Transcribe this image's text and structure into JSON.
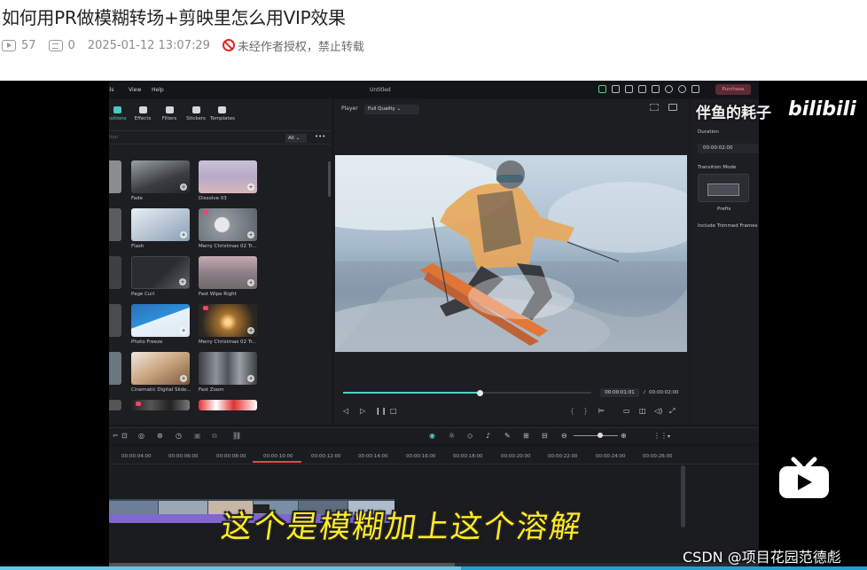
{
  "article": {
    "title": "如何用PR做模糊转场+剪映里怎么用VIP效果",
    "views": "57",
    "comments": "0",
    "datetime": "2025-01-12 13:07:29",
    "copyright": "未经作者授权，禁止转载"
  },
  "editor": {
    "menu": [
      "ols",
      "View",
      "Help"
    ],
    "window_title": "Untitled",
    "purchase_label": "Purchase",
    "categories": [
      "nsitions",
      "Effects",
      "Filters",
      "Stickers",
      "Templates"
    ],
    "search_placeholder": "ition",
    "filter_all": "All",
    "thumbnails": [
      {
        "label": "Fade"
      },
      {
        "label": "Dissolve 03"
      },
      {
        "label": "Flash"
      },
      {
        "label": "Merry Christmas 02 Tr..."
      },
      {
        "label": "Page Curl"
      },
      {
        "label": "Fast Wipe Right"
      },
      {
        "label": "Photo Freeze"
      },
      {
        "label": "Merry Christmas 02 Tr..."
      },
      {
        "label": "Cinematic Digital Slide..."
      },
      {
        "label": "Fast Zoom"
      }
    ],
    "player": {
      "label": "Player",
      "quality": "Full Quality",
      "current_time": "00:00:01:01",
      "separator": "/",
      "total_time": "00:00:02:00",
      "progress": 0.55
    },
    "properties": {
      "duration_label": "Duration",
      "duration_value": "00:00:02:00",
      "transition_mode_label": "Transition Mode",
      "mode_option": "Prefix",
      "include_trimmed": "Include Trimmed Frames"
    },
    "ruler_ticks": [
      "00:00:04:00",
      "00:00:06:00",
      "00:00:08:00",
      "00:00:10:00",
      "00:00:12:00",
      "00:00:14:00",
      "00:00:16:00",
      "00:00:18:00",
      "00:00:20:00",
      "00:00:22:00",
      "00:00:24:00",
      "00:00:26:00"
    ]
  },
  "subtitle": "这个是模糊加上这个溶解",
  "watermark": {
    "channel": "伴鱼的耗子",
    "brand": "bilibili",
    "csdn": "CSDN @项目花园范德彪"
  },
  "colors": {
    "accent": "#4fd0c8",
    "subtitle": "#ffeb25",
    "purchase": "#5b2a38",
    "clip_purple": "#8067d1",
    "no_repost": "#e0251d"
  }
}
